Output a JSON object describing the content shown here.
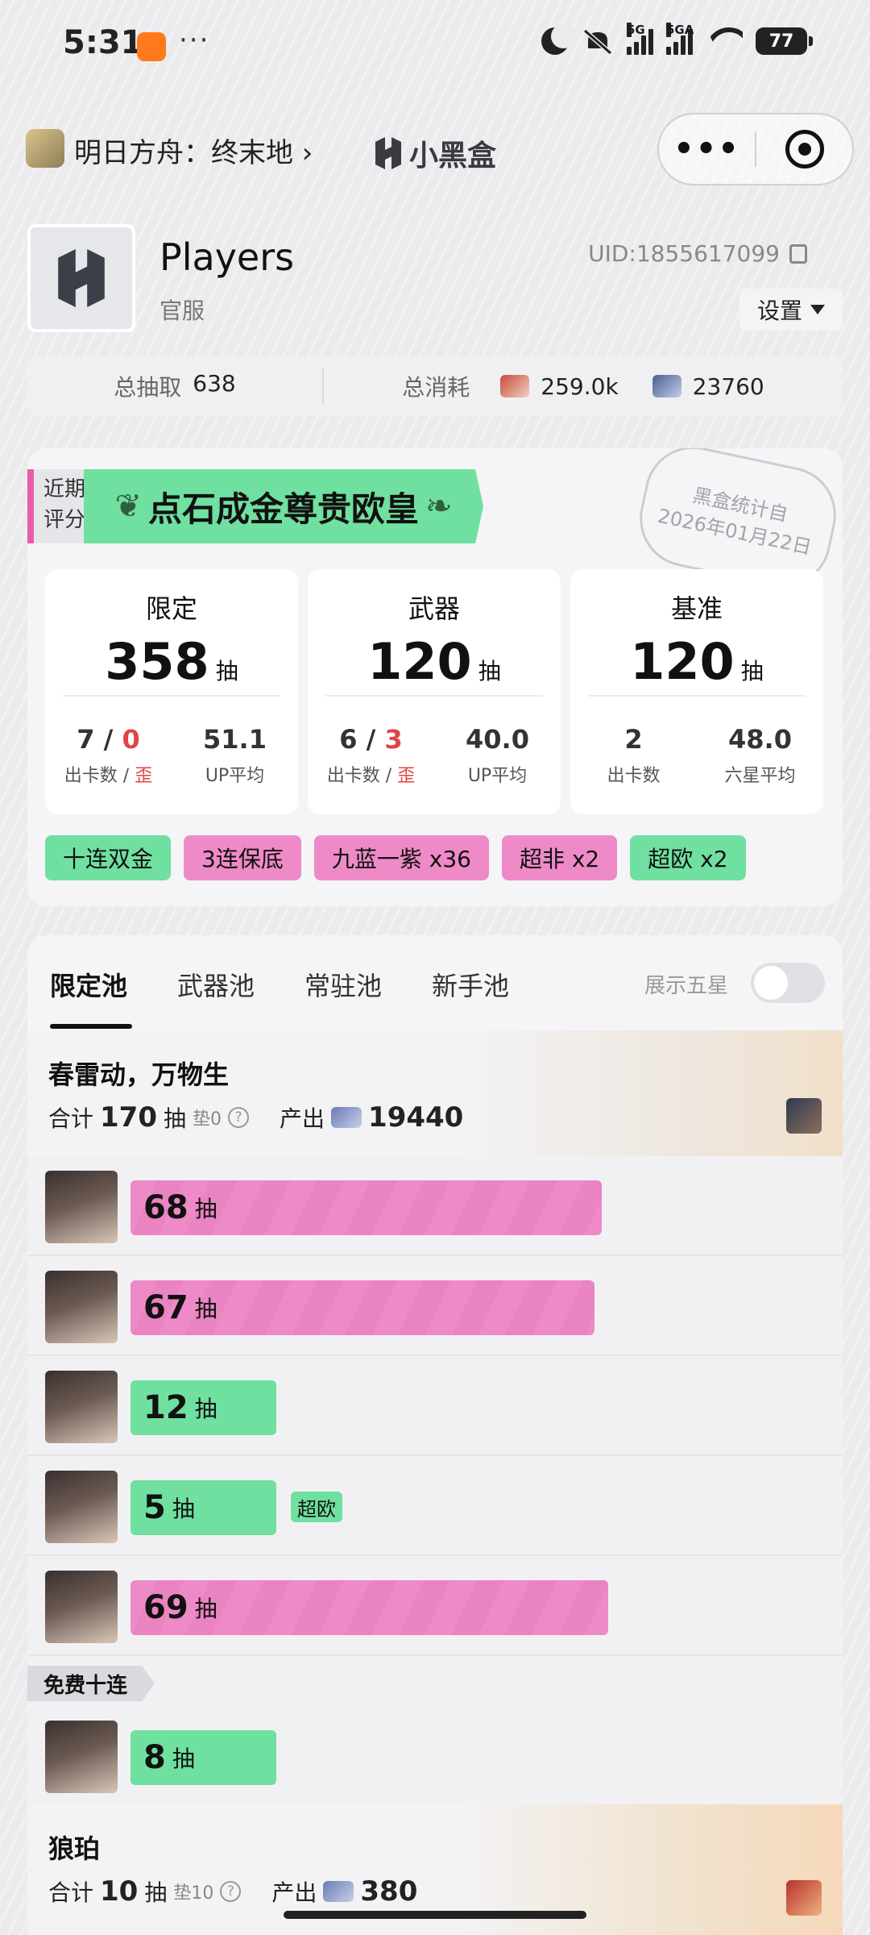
{
  "status_bar": {
    "time": "5:31",
    "more": "···",
    "net1": "5G",
    "net2": "5GA",
    "battery": "77"
  },
  "header": {
    "game_name": "明日方舟：终末地 ›",
    "brand": "小黑盒",
    "capsule_more": "•••"
  },
  "profile": {
    "name": "Players",
    "server": "官服",
    "uid": "UID:1855617099",
    "settings_label": "设置"
  },
  "summary": {
    "total_pulls_label": "总抽取",
    "total_pulls": "638",
    "total_cost_label": "总消耗",
    "cost_a": "259.0k",
    "cost_b": "23760"
  },
  "rating": {
    "tag_line1": "近期",
    "tag_line2": "评分",
    "title": "点石成金尊贵欧皇",
    "stamp_line1": "黑盒统计自",
    "stamp_line2": "2026年01月22日",
    "cards": [
      {
        "title": "限定",
        "pulls": "358",
        "unit": "抽",
        "left_val_a": "7",
        "left_sep": " / ",
        "left_val_b": "0",
        "left_lbl_a": "出卡数 / ",
        "left_lbl_b": "歪",
        "right_val": "51.1",
        "right_lbl": "UP平均"
      },
      {
        "title": "武器",
        "pulls": "120",
        "unit": "抽",
        "left_val_a": "6",
        "left_sep": " / ",
        "left_val_b": "3",
        "left_lbl_a": "出卡数 / ",
        "left_lbl_b": "歪",
        "right_val": "40.0",
        "right_lbl": "UP平均"
      },
      {
        "title": "基准",
        "pulls": "120",
        "unit": "抽",
        "left_val_a": "2",
        "left_lbl_a": "出卡数",
        "right_val": "48.0",
        "right_lbl": "六星平均"
      }
    ],
    "chips": [
      {
        "label": "十连双金",
        "color": "green"
      },
      {
        "label": "3连保底",
        "color": "pink"
      },
      {
        "label": "九蓝一紫 x36",
        "color": "pink"
      },
      {
        "label": "超非 x2",
        "color": "pink"
      },
      {
        "label": "超欧 x2",
        "color": "green"
      }
    ]
  },
  "pools": {
    "tabs": [
      "限定池",
      "武器池",
      "常驻池",
      "新手池"
    ],
    "active_tab": 0,
    "toggle_label": "展示五星",
    "pool1": {
      "title": "春雷动，万物生",
      "total_label": "合计",
      "total": "170",
      "unit": "抽",
      "pity": "垫0",
      "output_label": "产出",
      "output": "19440"
    },
    "pulls": [
      {
        "count": "68",
        "unit": "抽",
        "color": "pink",
        "fill": 0.68
      },
      {
        "count": "67",
        "unit": "抽",
        "color": "pink",
        "fill": 0.67
      },
      {
        "count": "12",
        "unit": "抽",
        "color": "green",
        "fill": 0.21
      },
      {
        "count": "5",
        "unit": "抽",
        "color": "green",
        "fill": 0.21,
        "badge": "超欧"
      },
      {
        "count": "69",
        "unit": "抽",
        "color": "pink",
        "fill": 0.69
      }
    ],
    "free_tag": "免费十连",
    "free_pull": {
      "count": "8",
      "unit": "抽",
      "color": "green",
      "fill": 0.21
    },
    "pool2": {
      "title": "狼珀",
      "total_label": "合计",
      "total": "10",
      "unit": "抽",
      "pity": "垫10",
      "output_label": "产出",
      "output": "380"
    }
  },
  "colors": {
    "green": "#6fe0a0",
    "pink": "#ee8ac7",
    "red": "#e04444"
  }
}
